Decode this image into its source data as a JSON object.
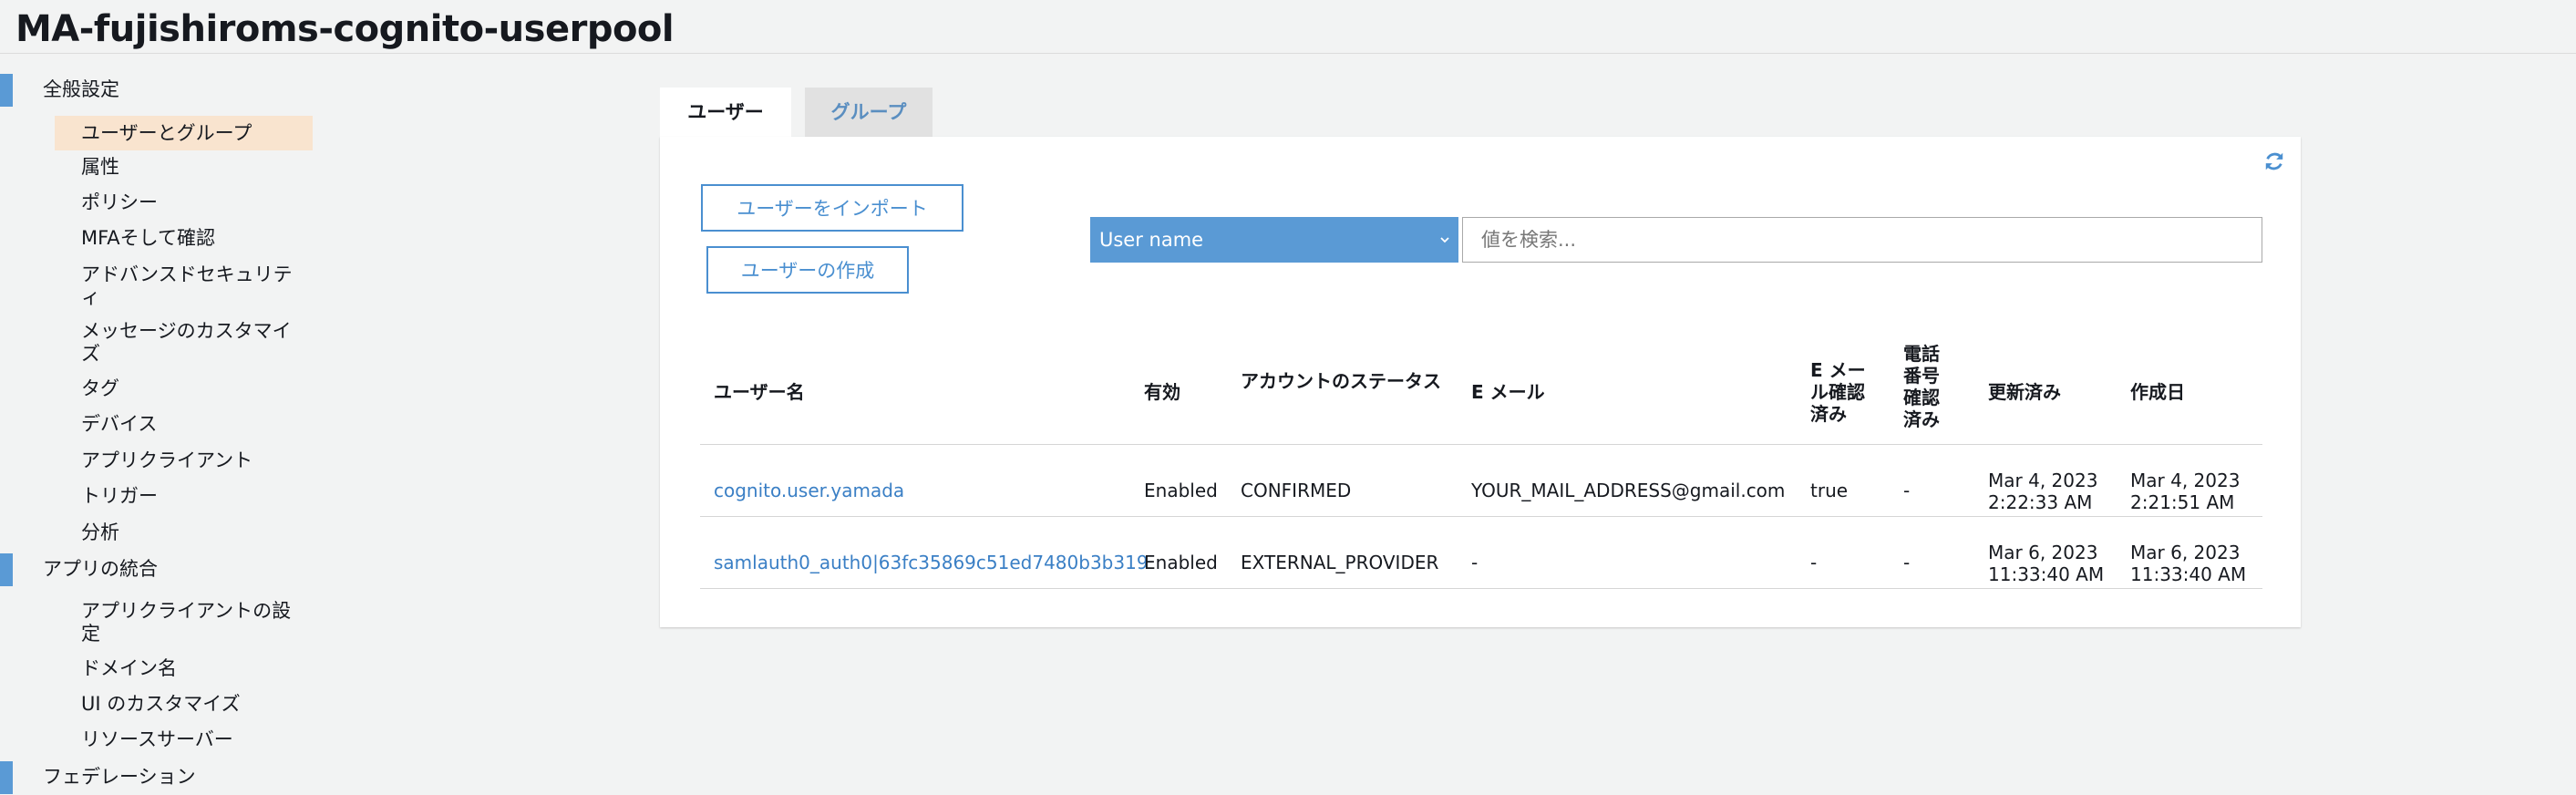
{
  "page": {
    "title": "MA-fujishiroms-cognito-userpool"
  },
  "sidebar": {
    "sections": [
      {
        "label": "全般設定"
      },
      {
        "label": "アプリの統合"
      },
      {
        "label": "フェデレーション"
      }
    ],
    "general_items": [
      {
        "label": "ユーザーとグループ",
        "active": true
      },
      {
        "label": "属性"
      },
      {
        "label": "ポリシー"
      },
      {
        "label": "MFAそして確認"
      },
      {
        "label": "アドバンスドセキュリティ"
      },
      {
        "label": "メッセージのカスタマイズ"
      },
      {
        "label": "タグ"
      },
      {
        "label": "デバイス"
      },
      {
        "label": "アプリクライアント"
      },
      {
        "label": "トリガー"
      },
      {
        "label": "分析"
      }
    ],
    "app_items": [
      {
        "label": "アプリクライアントの設定"
      },
      {
        "label": "ドメイン名"
      },
      {
        "label": "UI のカスタマイズ"
      },
      {
        "label": "リソースサーバー"
      }
    ]
  },
  "tabs": {
    "users": "ユーザー",
    "groups": "グループ"
  },
  "actions": {
    "import_label": "ユーザーをインポート",
    "create_label": "ユーザーの作成"
  },
  "search": {
    "attribute": "User name",
    "placeholder": "値を検索..."
  },
  "table": {
    "headers": {
      "username": "ユーザー名",
      "enabled": "有効",
      "status": "アカウントのステータス",
      "email": "E メール",
      "email_verified": "E メール確認済み",
      "phone_verified": "電話番号確認済み",
      "updated": "更新済み",
      "created": "作成日"
    },
    "rows": [
      {
        "username": "cognito.user.yamada",
        "enabled": "Enabled",
        "status": "CONFIRMED",
        "email": "YOUR_MAIL_ADDRESS@gmail.com",
        "email_verified": "true",
        "phone_verified": "-",
        "updated": "Mar 4, 2023 2:22:33 AM",
        "created": "Mar 4, 2023 2:21:51 AM"
      },
      {
        "username": "samlauth0_auth0|63fc35869c51ed7480b3b319",
        "enabled": "Enabled",
        "status": "EXTERNAL_PROVIDER",
        "email": "-",
        "email_verified": "-",
        "phone_verified": "-",
        "updated": "Mar 6, 2023 11:33:40 AM",
        "created": "Mar 6, 2023 11:33:40 AM"
      }
    ]
  },
  "colors": {
    "accent": "#5a9ad5",
    "link": "#3a7fc5",
    "active_bg": "#f9e4cf"
  }
}
